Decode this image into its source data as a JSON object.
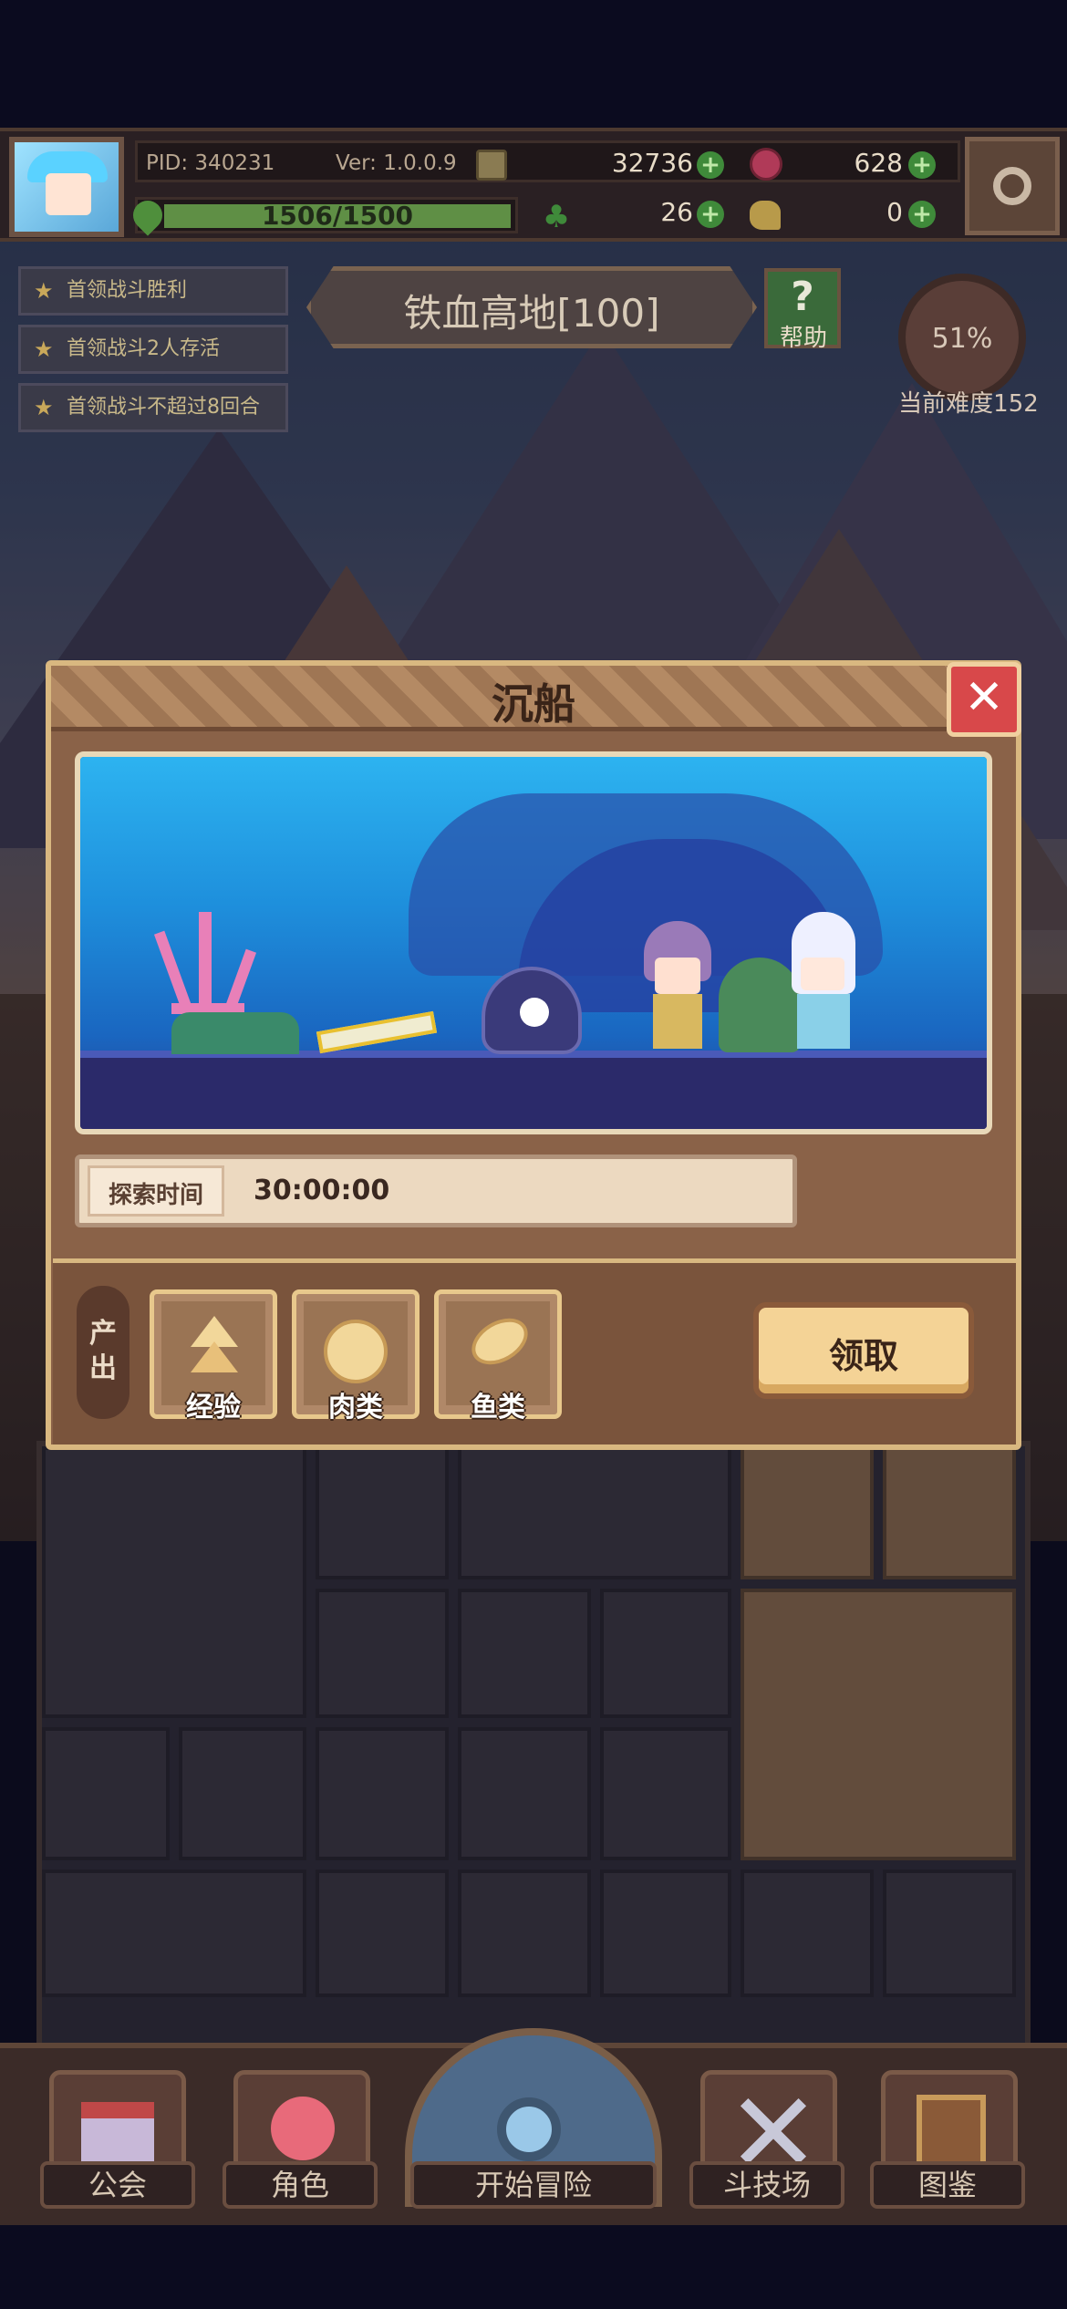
{
  "top_bar": {
    "pid": "PID: 340231",
    "version": "Ver: 1.0.0.9",
    "gold": "32736",
    "gems": "628",
    "stamina": "1506/1500",
    "stamina_fraction": 1.0,
    "clover": "26",
    "meat": "0",
    "plus_glyph": "+",
    "clover_glyph": "♣",
    "icons": [
      "avatar",
      "coin-icon",
      "gem-icon",
      "clover-icon",
      "meat-icon",
      "gear-icon"
    ]
  },
  "quests": [
    {
      "star": "★",
      "label": "首领战斗胜利"
    },
    {
      "star": "★",
      "label": "首领战斗2人存活"
    },
    {
      "star": "★",
      "label": "首领战斗不超过8回合"
    }
  ],
  "stage": {
    "title": "铁血高地[100]",
    "help_glyph": "?",
    "help_label": "帮助",
    "progress": "51%",
    "difficulty": "当前难度152"
  },
  "modal": {
    "title": "沉船",
    "close_glyph": "✕",
    "time_label": "探索时间",
    "time_value": "30:00:00",
    "output_label": "产出",
    "outputs": [
      {
        "label": "经验",
        "icon": "experience-icon"
      },
      {
        "label": "肉类",
        "icon": "meat-icon"
      },
      {
        "label": "鱼类",
        "icon": "fish-icon"
      }
    ],
    "claim_button": "领取"
  },
  "bottom_nav": {
    "guild": "公会",
    "role": "角色",
    "adventure": "开始冒险",
    "arena": "斗技场",
    "codex": "图鉴"
  },
  "colors": {
    "modal_frame": "#d9b880",
    "close_red": "#d8484a",
    "water": "#1e8fdc",
    "claim": "#f4d396"
  }
}
